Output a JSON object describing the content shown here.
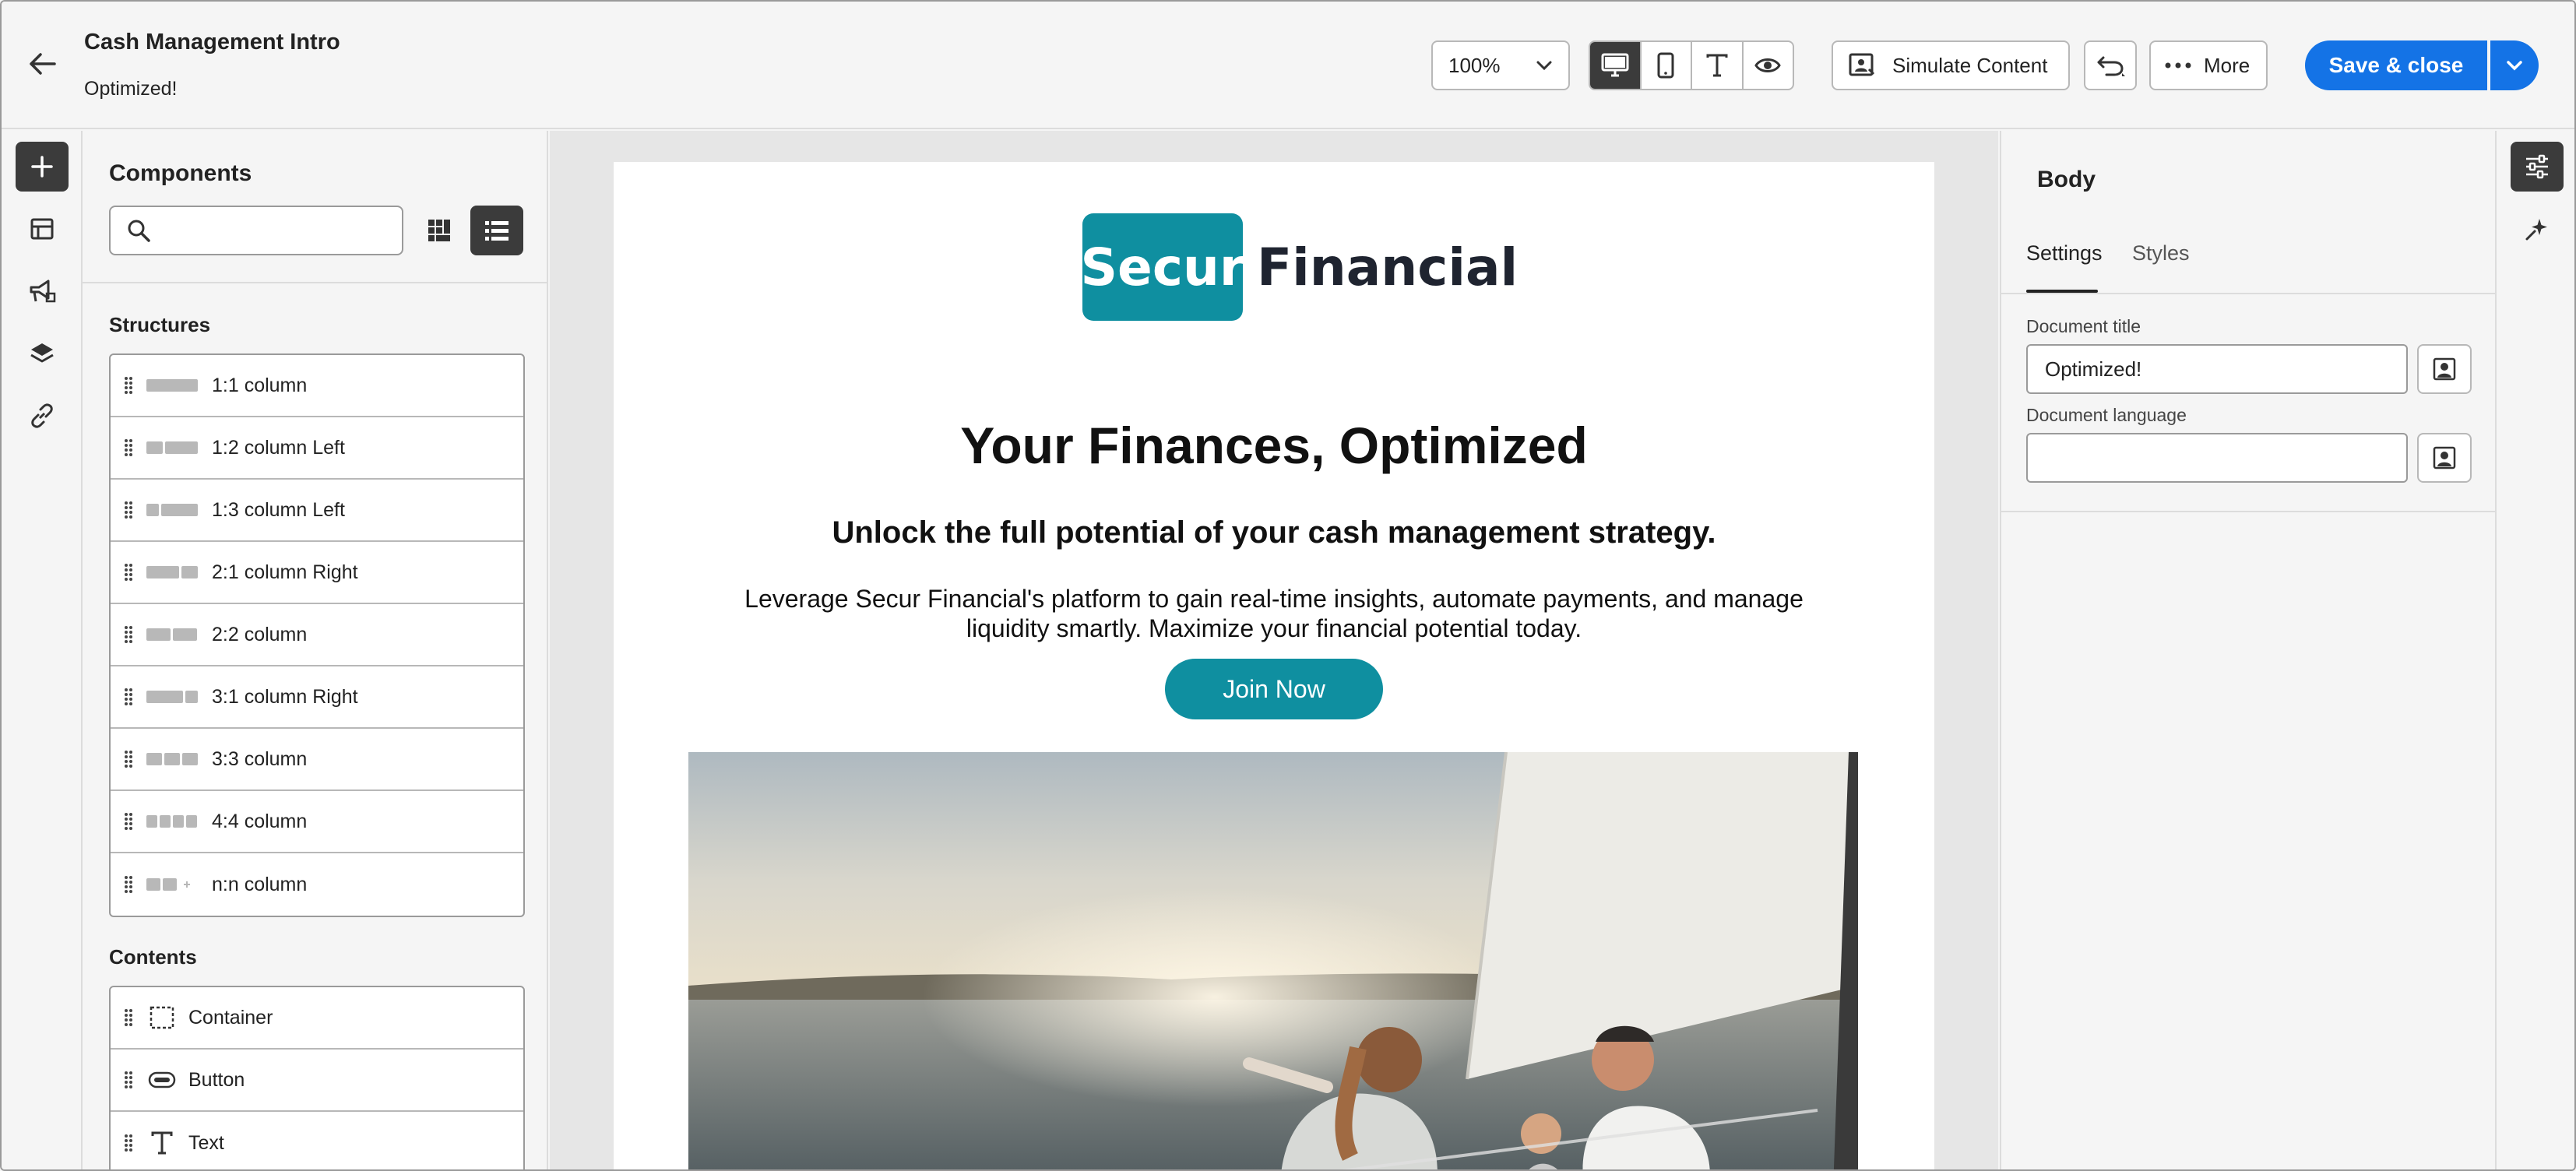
{
  "header": {
    "title": "Cash Management Intro",
    "subtitle": "Optimized!",
    "zoom": "100%",
    "simulate_label": "Simulate Content",
    "more_label": "More",
    "save_label": "Save & close",
    "accent_color": "#1473e6"
  },
  "components": {
    "title": "Components",
    "search_placeholder": "",
    "structures_label": "Structures",
    "structures": [
      {
        "label": "1:1 column"
      },
      {
        "label": "1:2 column Left"
      },
      {
        "label": "1:3 column Left"
      },
      {
        "label": "2:1 column Right"
      },
      {
        "label": "2:2 column"
      },
      {
        "label": "3:1 column Right"
      },
      {
        "label": "3:3 column"
      },
      {
        "label": "4:4 column"
      },
      {
        "label": "n:n column"
      }
    ],
    "contents_label": "Contents",
    "contents": [
      {
        "label": "Container",
        "icon": "container-icon"
      },
      {
        "label": "Button",
        "icon": "button-icon"
      },
      {
        "label": "Text",
        "icon": "text-icon"
      }
    ]
  },
  "email": {
    "logo_box": "Secur",
    "logo_text": "Financial",
    "headline": "Your Finances, Optimized",
    "subheadline": "Unlock the full potential of your cash management strategy.",
    "body": "Leverage Secur Financial's platform to gain real-time insights, automate payments, and manage liquidity smartly. Maximize your financial potential today.",
    "cta": "Join Now",
    "brand_color": "#0f8fa0"
  },
  "settings": {
    "title": "Body",
    "tabs": [
      "Settings",
      "Styles"
    ],
    "active_tab": "Settings",
    "doc_title_label": "Document title",
    "doc_title_value": "Optimized!",
    "doc_language_label": "Document language",
    "doc_language_value": ""
  }
}
